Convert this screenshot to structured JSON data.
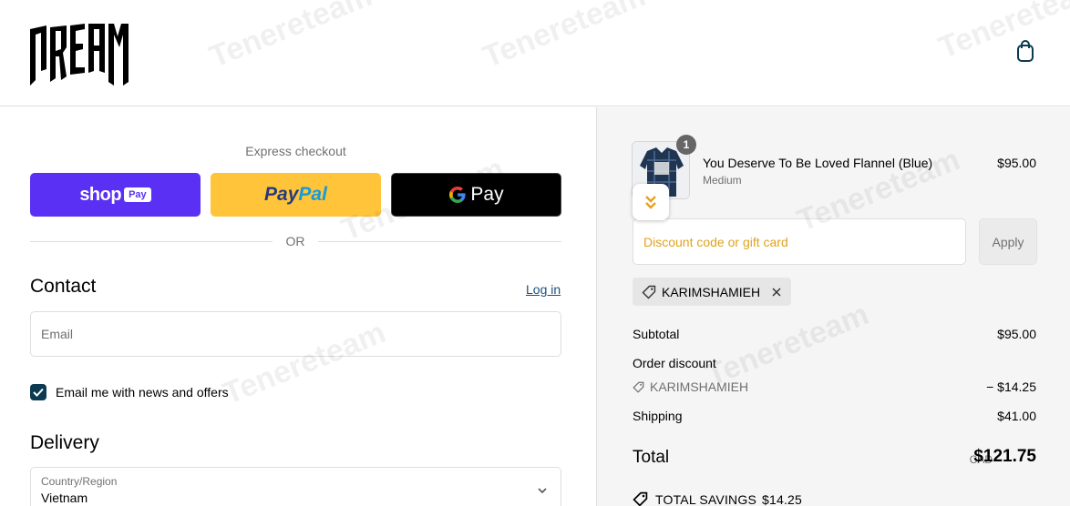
{
  "header": {
    "logo_text": "DREAM",
    "cart_icon": "shopping-bag-icon"
  },
  "express": {
    "title": "Express checkout",
    "shop_pay": {
      "word": "shop",
      "badge": "Pay",
      "color": "#5a31f4"
    },
    "paypal": {
      "part1": "Pay",
      "part2": "Pal",
      "color": "#ffc439"
    },
    "gpay": {
      "g": "G",
      "text": "Pay",
      "color": "#000000"
    },
    "or_text": "OR"
  },
  "contact": {
    "title": "Contact",
    "login_link": "Log in",
    "email_placeholder": "Email",
    "newsletter_label": "Email me with news and offers",
    "newsletter_checked": true
  },
  "delivery": {
    "title": "Delivery",
    "country_label": "Country/Region",
    "country_value": "Vietnam"
  },
  "summary": {
    "product": {
      "name": "You Deserve To Be Loved Flannel (Blue)",
      "variant": "Medium",
      "price": "$95.00",
      "quantity": "1"
    },
    "discount_placeholder": "Discount code or gift card",
    "apply_label": "Apply",
    "applied_code": "KARIMSHAMIEH",
    "subtotal_label": "Subtotal",
    "subtotal_value": "$95.00",
    "order_discount_label": "Order discount",
    "order_discount_code": "KARIMSHAMIEH",
    "order_discount_value": "− $14.25",
    "shipping_label": "Shipping",
    "shipping_value": "$41.00",
    "total_label": "Total",
    "total_currency": "CAD",
    "total_value": "$121.75",
    "savings_label": "TOTAL SAVINGS",
    "savings_value": "$14.25"
  },
  "watermark": "Tenereteam",
  "colors": {
    "accent": "#0b3a51",
    "link": "#1c4f7c",
    "discount_placeholder": "#e1a21c",
    "summary_bg": "#f5f5f5"
  }
}
